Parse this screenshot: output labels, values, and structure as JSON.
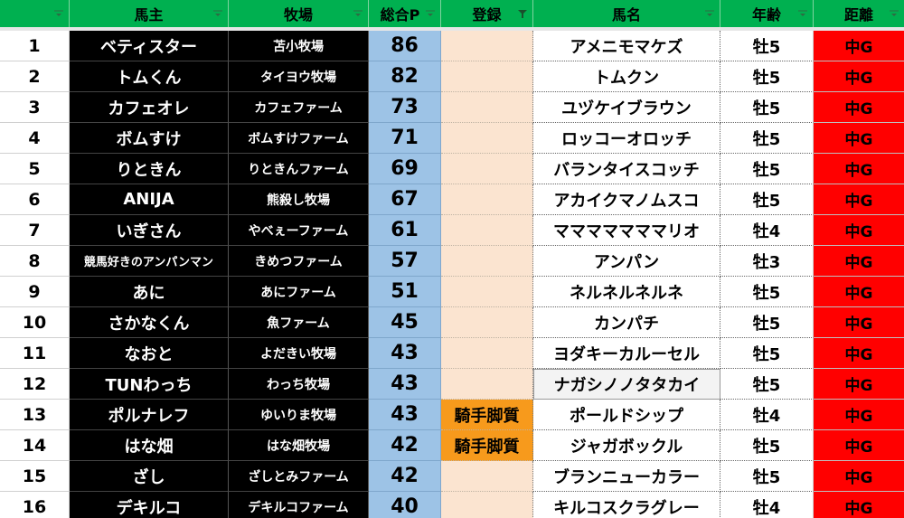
{
  "headers": {
    "owner": "馬主",
    "farm": "牧場",
    "points": "総合P",
    "registration": "登録",
    "horse": "馬名",
    "age": "年齢",
    "distance": "距離"
  },
  "rows": [
    {
      "rank": "1",
      "owner": "ベティスター",
      "farm": "苫小牧場",
      "points": "86",
      "registration": "",
      "horse": "アメニモマケズ",
      "age": "牡5",
      "distance": "中G"
    },
    {
      "rank": "2",
      "owner": "トムくん",
      "farm": "タイヨウ牧場",
      "points": "82",
      "registration": "",
      "horse": "トムクン",
      "age": "牡5",
      "distance": "中G"
    },
    {
      "rank": "3",
      "owner": "カフェオレ",
      "farm": "カフェファーム",
      "points": "73",
      "registration": "",
      "horse": "ユヅケイブラウン",
      "age": "牡5",
      "distance": "中G"
    },
    {
      "rank": "4",
      "owner": "ボムすけ",
      "farm": "ボムすけファーム",
      "points": "71",
      "registration": "",
      "horse": "ロッコーオロッチ",
      "age": "牡5",
      "distance": "中G"
    },
    {
      "rank": "5",
      "owner": "りときん",
      "farm": "りときんファーム",
      "points": "69",
      "registration": "",
      "horse": "バランタイスコッチ",
      "age": "牡5",
      "distance": "中G"
    },
    {
      "rank": "6",
      "owner": "ANIJA",
      "farm": "熊殺し牧場",
      "points": "67",
      "registration": "",
      "horse": "アカイクマノムスコ",
      "age": "牡5",
      "distance": "中G"
    },
    {
      "rank": "7",
      "owner": "いぎさん",
      "farm": "やべぇーファーム",
      "points": "61",
      "registration": "",
      "horse": "マママママママリオ",
      "age": "牡4",
      "distance": "中G"
    },
    {
      "rank": "8",
      "owner": "競馬好きのアンパンマン",
      "farm": "きめつファーム",
      "points": "57",
      "registration": "",
      "horse": "アンパン",
      "age": "牡3",
      "distance": "中G"
    },
    {
      "rank": "9",
      "owner": "あに",
      "farm": "あにファーム",
      "points": "51",
      "registration": "",
      "horse": "ネルネルネルネ",
      "age": "牡5",
      "distance": "中G"
    },
    {
      "rank": "10",
      "owner": "さかなくん",
      "farm": "魚ファーム",
      "points": "45",
      "registration": "",
      "horse": "カンパチ",
      "age": "牡5",
      "distance": "中G"
    },
    {
      "rank": "11",
      "owner": "なおと",
      "farm": "よだきい牧場",
      "points": "43",
      "registration": "",
      "horse": "ヨダキーカルーセル",
      "age": "牡5",
      "distance": "中G"
    },
    {
      "rank": "12",
      "owner": "TUNわっち",
      "farm": "わっち牧場",
      "points": "43",
      "registration": "",
      "horse": "ナガシノノタタカイ",
      "age": "牡5",
      "distance": "中G"
    },
    {
      "rank": "13",
      "owner": "ポルナレフ",
      "farm": "ゆいりま牧場",
      "points": "43",
      "registration": "騎手脚質",
      "horse": "ポールドシップ",
      "age": "牡4",
      "distance": "中G"
    },
    {
      "rank": "14",
      "owner": "はな畑",
      "farm": "はな畑牧場",
      "points": "42",
      "registration": "騎手脚質",
      "horse": "ジャガボックル",
      "age": "牡5",
      "distance": "中G"
    },
    {
      "rank": "15",
      "owner": "ざし",
      "farm": "ざしとみファーム",
      "points": "42",
      "registration": "",
      "horse": "ブランニューカラー",
      "age": "牡5",
      "distance": "中G"
    },
    {
      "rank": "16",
      "owner": "デキルコ",
      "farm": "デキルコファーム",
      "points": "40",
      "registration": "",
      "horse": "キルコスクラグレー",
      "age": "牡4",
      "distance": "中G"
    }
  ],
  "colors": {
    "header_bg": "#00b050",
    "owner_bg": "#000000",
    "points_bg": "#9dc3e6",
    "registration_bg": "#fbe4d0",
    "registration_tag_bg": "#f79a1c",
    "distance_bg": "#ff0000"
  },
  "icons": {
    "filter_dropdown": "filter-dropdown-icon",
    "filter_active": "filter-active-icon"
  }
}
